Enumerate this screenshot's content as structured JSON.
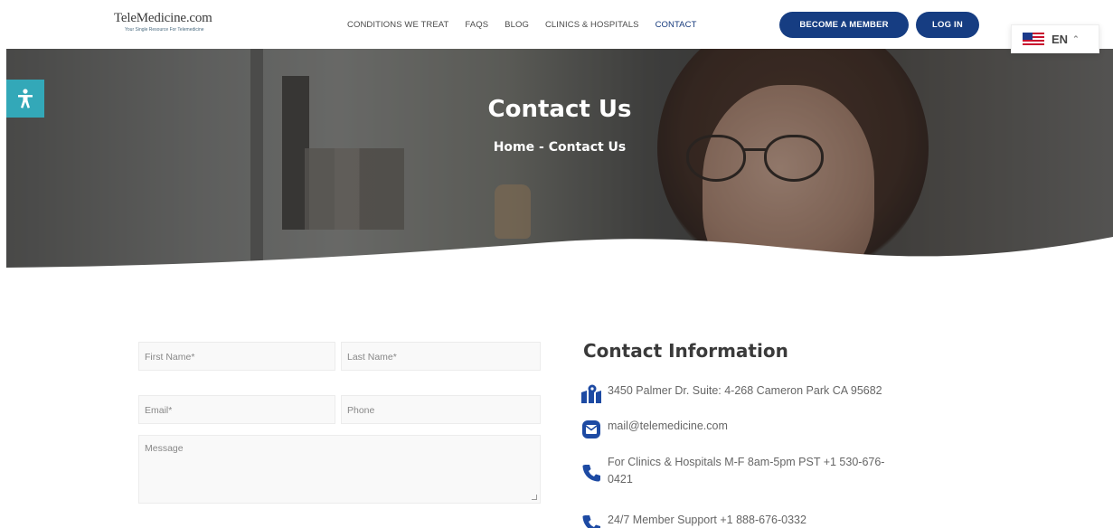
{
  "logo": {
    "name": "TeleMedicine.com",
    "tagline": "Your Single Resource For Telemedicine"
  },
  "nav": {
    "items": [
      "CONDITIONS WE TREAT",
      "FAQS",
      "BLOG",
      "CLINICS & HOSPITALS",
      "CONTACT"
    ],
    "active": "CONTACT",
    "member_button": "BECOME A MEMBER",
    "login_button": "LOG IN"
  },
  "language": {
    "code": "EN",
    "flag": "us-flag-icon"
  },
  "hero": {
    "title": "Contact Us",
    "breadcrumb": "Home - Contact Us"
  },
  "form": {
    "first_name": "First Name*",
    "last_name": "Last Name*",
    "email": "Email*",
    "phone": "Phone",
    "message": "Message"
  },
  "contact_info": {
    "title": "Contact Information",
    "address": "3450 Palmer Dr. Suite: 4-268 Cameron Park CA 95682",
    "email": "mail@telemedicine.com",
    "clinic_phone_line1": "For Clinics & Hospitals M-F 8am-5pm PST +1 530-676-",
    "clinic_phone_line2": "0421",
    "support_phone": "24/7 Member Support +1 888-676-0332"
  },
  "colors": {
    "brand": "#163d82",
    "accessibility": "#33a8b8",
    "icon": "#1d4aa3"
  }
}
